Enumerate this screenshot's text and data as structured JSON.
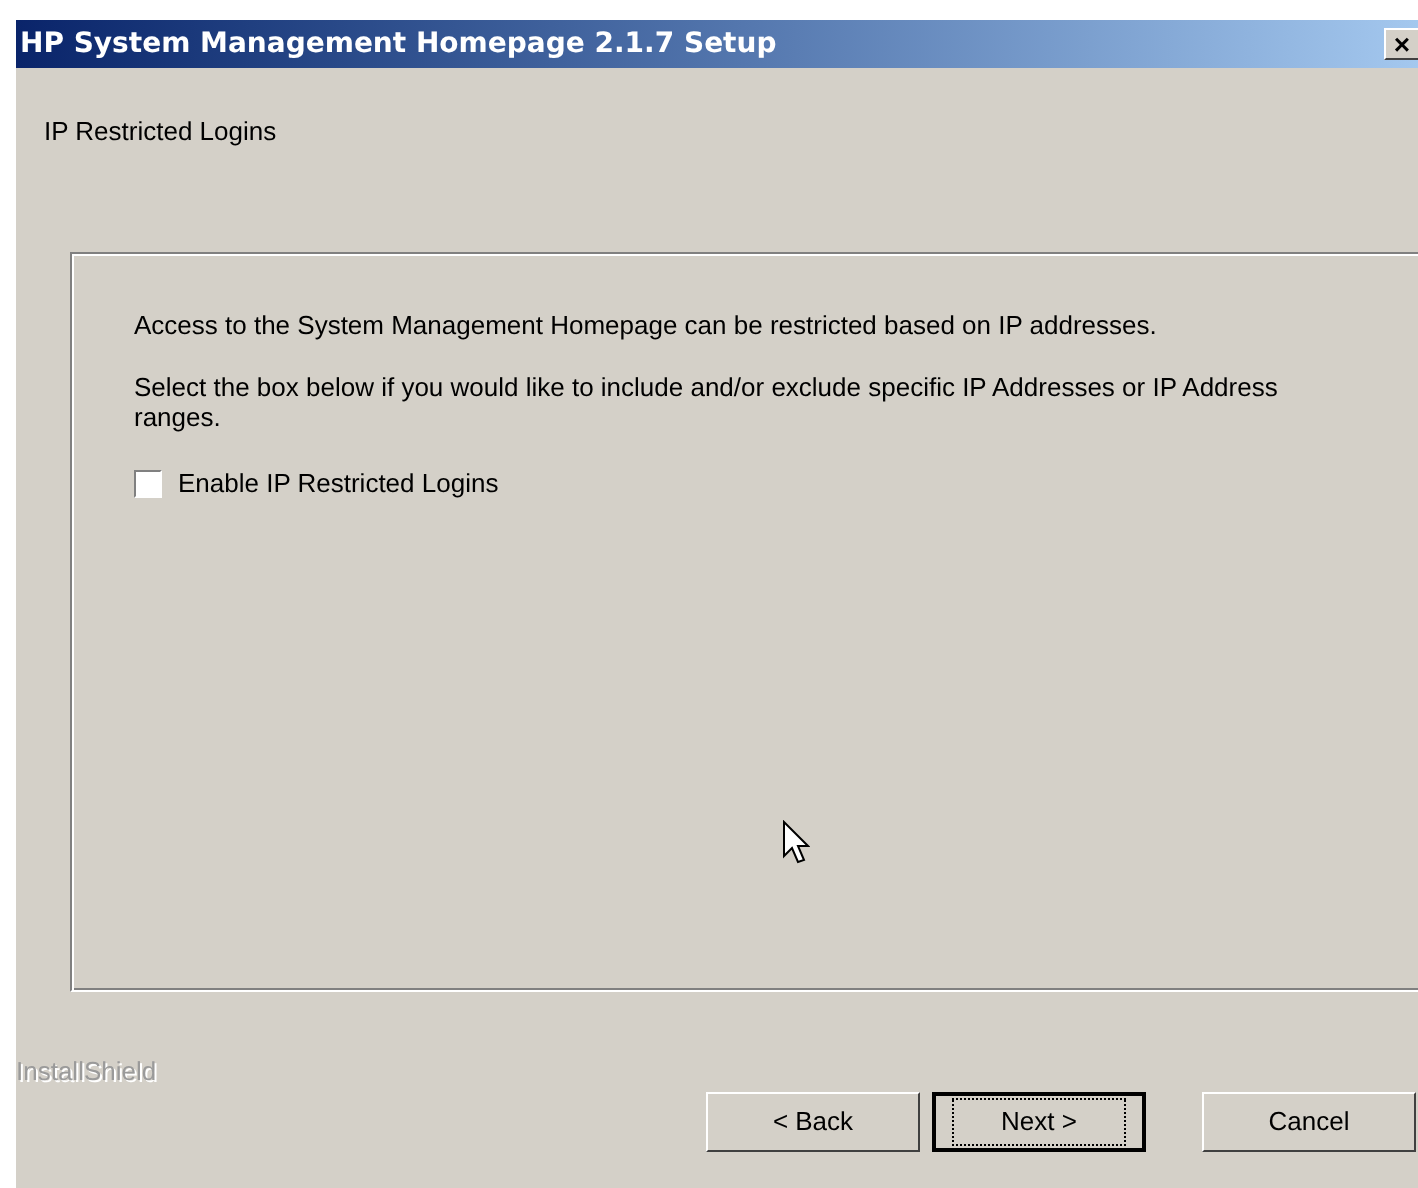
{
  "window": {
    "title": "HP System Management Homepage 2.1.7 Setup",
    "close": "×"
  },
  "header": {
    "title": "IP Restricted Logins"
  },
  "panel": {
    "paragraphs": [
      "Access  to the System Management Homepage can be restricted based on IP addresses.",
      "Select the box below if you would like to include and/or exclude specific IP Addresses or IP Address ranges."
    ],
    "checkbox": {
      "label": "Enable IP Restricted Logins",
      "checked": false
    }
  },
  "brand": "InstallShield",
  "buttons": [
    {
      "label": "< Back",
      "default": false
    },
    {
      "label": "Next >",
      "default": true
    },
    {
      "label": "Cancel",
      "default": false
    }
  ]
}
